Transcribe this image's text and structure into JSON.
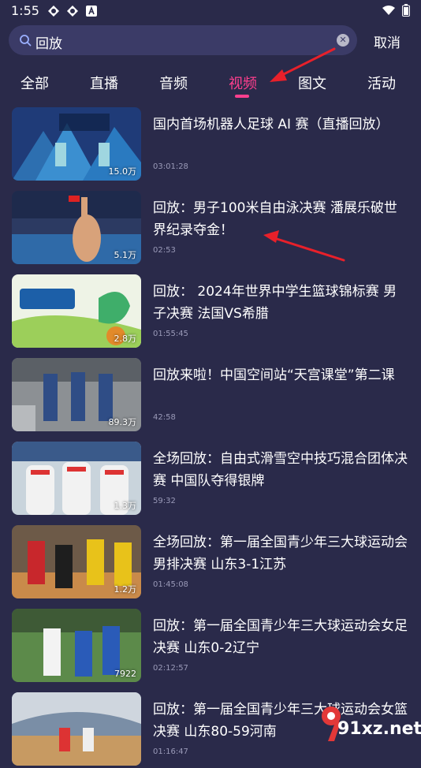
{
  "status_bar": {
    "time": "1:55",
    "left_icons": [
      "app-icon",
      "app-icon",
      "app-a-icon"
    ],
    "right_icons": [
      "wifi-icon",
      "battery-icon"
    ]
  },
  "search": {
    "value": "回放",
    "cancel_label": "取消"
  },
  "tabs": [
    {
      "label": "全部"
    },
    {
      "label": "直播"
    },
    {
      "label": "音频"
    },
    {
      "label": "视频"
    },
    {
      "label": "图文"
    },
    {
      "label": "活动"
    }
  ],
  "active_tab": "视频",
  "videos": [
    {
      "title": "国内首场机器人足球 AI 赛（直播回放）",
      "duration": "03:01:28",
      "views": "15.0万"
    },
    {
      "title": "回放：男子100米自由泳决赛 潘展乐破世界纪录夺金！",
      "duration": "02:53",
      "views": "5.1万"
    },
    {
      "title": "回放： 2024年世界中学生篮球锦标赛 男子决赛 法国VS希腊",
      "duration": "01:55:45",
      "views": "2.8万"
    },
    {
      "title": "回放来啦！中国空间站“天宫课堂”第二课",
      "duration": "42:58",
      "views": "89.3万"
    },
    {
      "title": "全场回放：自由式滑雪空中技巧混合团体决赛 中国队夺得银牌",
      "duration": "59:32",
      "views": "1.3万"
    },
    {
      "title": "全场回放：第一届全国青少年三大球运动会男排决赛 山东3-1江苏",
      "duration": "01:45:08",
      "views": "1.2万"
    },
    {
      "title": "回放：第一届全国青少年三大球运动会女足决赛 山东0-2辽宁",
      "duration": "02:12:57",
      "views": "7922"
    },
    {
      "title": "回放：第一届全国青少年三大球运动会女篮决赛 山东80-59河南",
      "duration": "01:16:47",
      "views": ""
    }
  ],
  "watermark": {
    "text": "91xz.net"
  },
  "colors": {
    "background": "#2a2a4a",
    "search_box": "#3b3b67",
    "accent": "#ff3f8e",
    "annotation_arrow": "#e8202a",
    "muted_text": "#9a9ab8"
  }
}
